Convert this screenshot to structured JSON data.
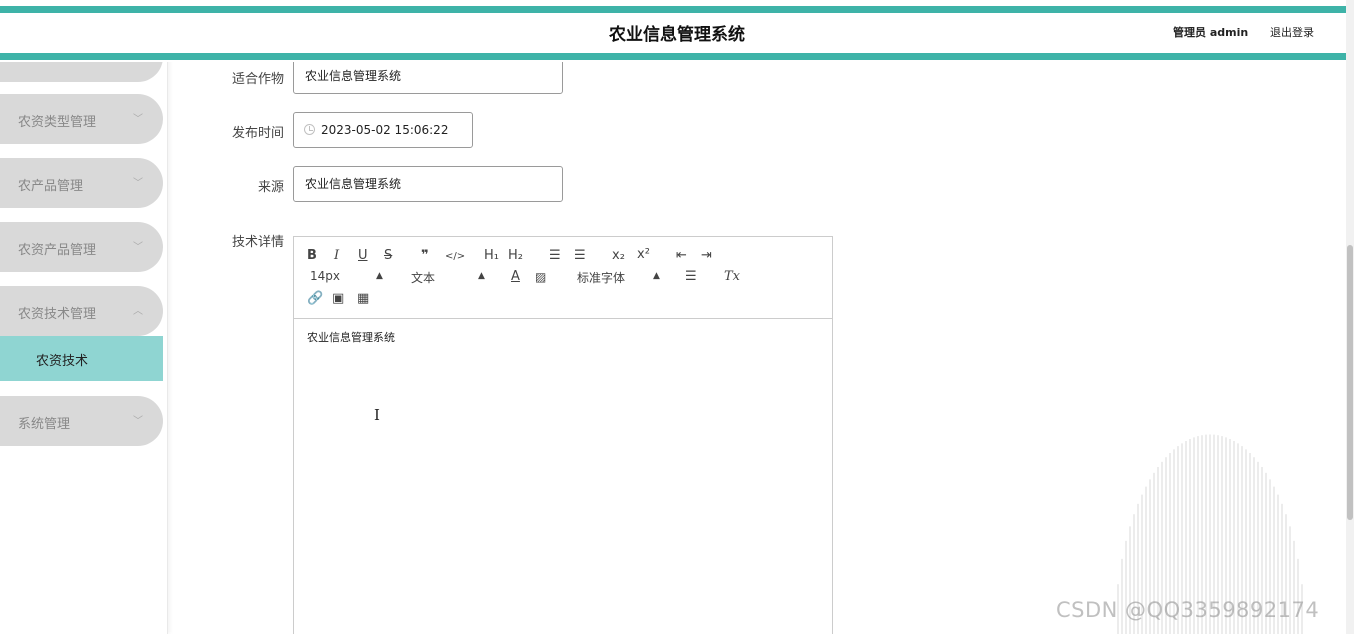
{
  "header": {
    "title": "农业信息管理系统",
    "admin_label": "管理员 admin",
    "logout_label": "退出登录",
    "accent_color": "#3eb3a8"
  },
  "sidebar": {
    "items": [
      {
        "label": "农资类型管理",
        "icon": "chevron-down-icon"
      },
      {
        "label": "农产品管理",
        "icon": "chevron-down-icon"
      },
      {
        "label": "农资产品管理",
        "icon": "chevron-down-icon"
      },
      {
        "label": "农资技术管理",
        "icon": "chevron-up-icon",
        "expanded": true
      },
      {
        "label": "系统管理",
        "icon": "chevron-down-icon"
      }
    ],
    "subitem": {
      "label": "农资技术",
      "active": true,
      "color": "#8fd5d2"
    }
  },
  "form": {
    "crop": {
      "label": "适合作物",
      "value": "农业信息管理系统"
    },
    "publish_time": {
      "label": "发布时间",
      "value": "2023-05-02 15:06:22",
      "icon": "clock-icon"
    },
    "source": {
      "label": "来源",
      "value": "农业信息管理系统"
    },
    "detail": {
      "label": "技术详情"
    }
  },
  "editor": {
    "toolbar": {
      "bold": "B",
      "italic": "I",
      "underline": "U",
      "strike": "S",
      "blockquote": "❞",
      "code": "</>",
      "h1": "H₁",
      "h2": "H₂",
      "ordered_list": "☰",
      "bullet_list": "☰",
      "subscript": "x₂",
      "superscript": "x²",
      "outdent": "⇤",
      "indent": "⇥",
      "font_size": "14px",
      "text_type": "文本",
      "font_family": "标准字体",
      "clear_format": "Tx"
    },
    "content": "农业信息管理系统"
  },
  "watermark": "CSDN @QQ3359892174"
}
